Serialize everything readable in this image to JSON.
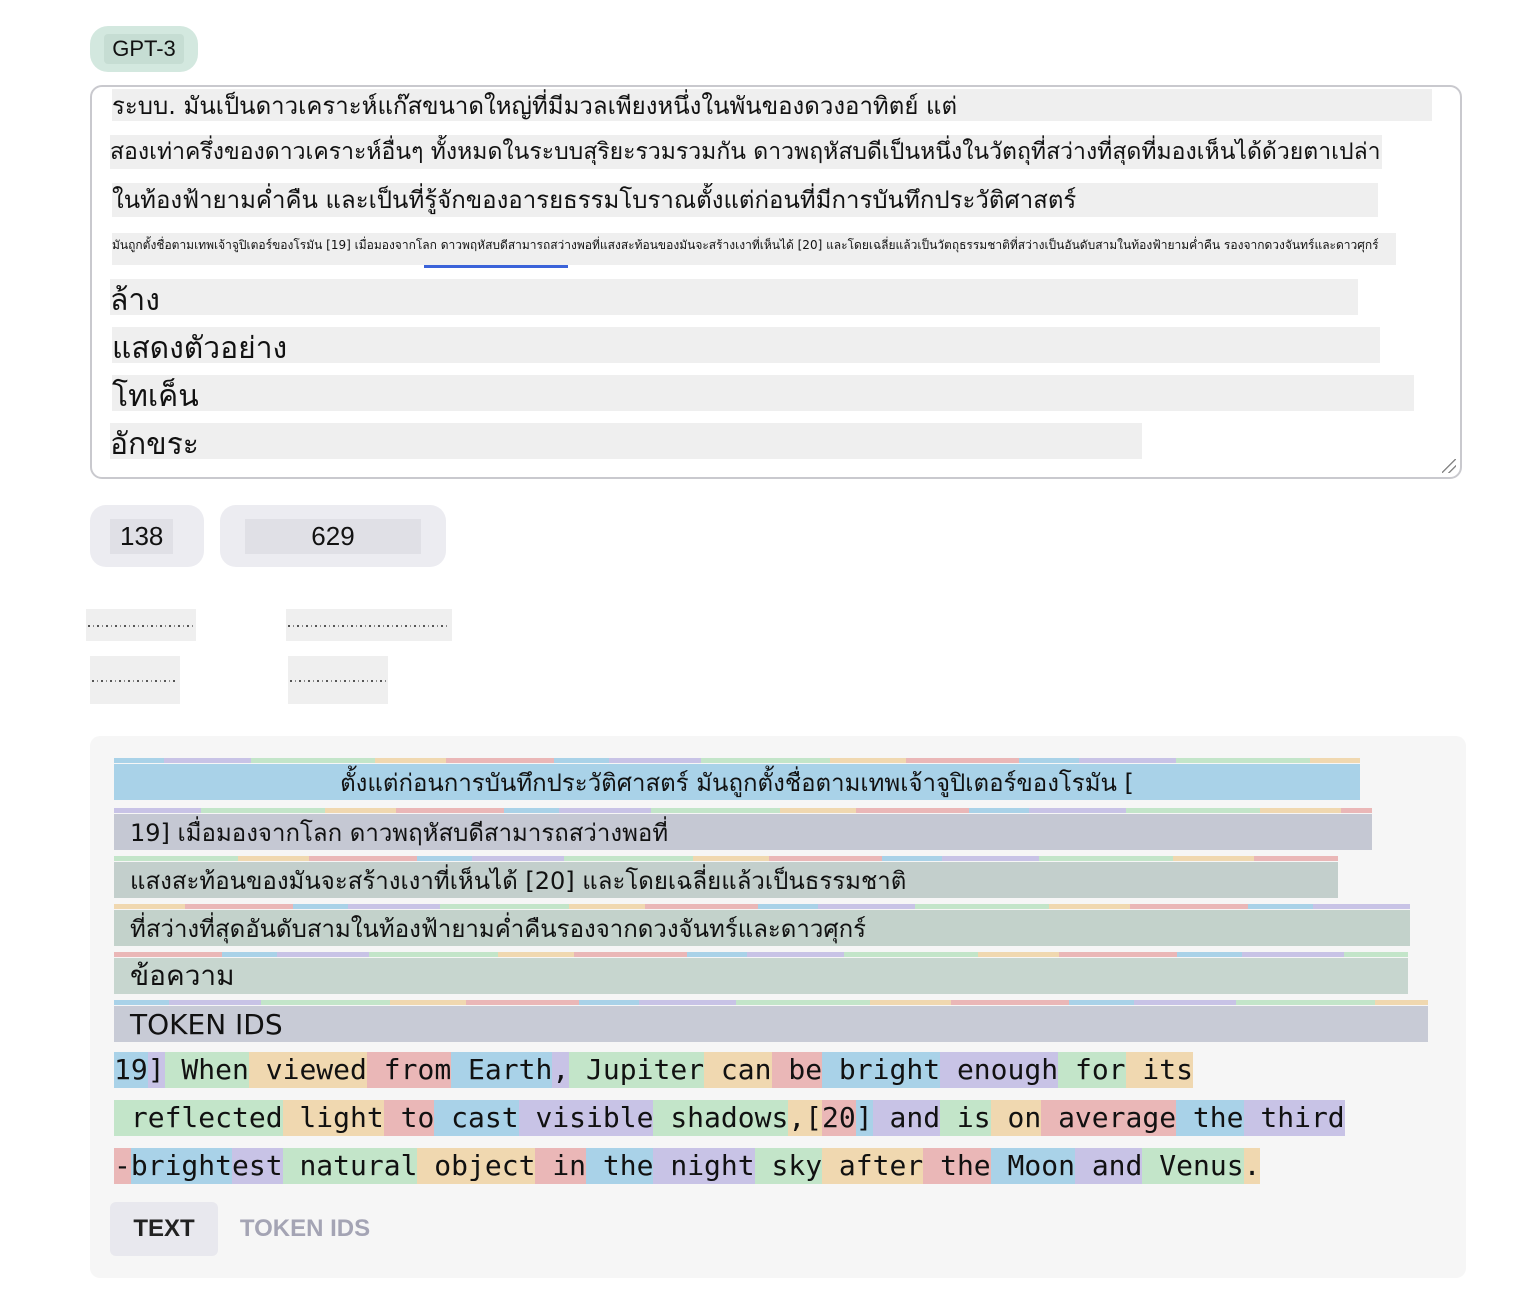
{
  "model": {
    "label": "GPT-3"
  },
  "textarea": {
    "lines": [
      "ระบบ. มันเป็นดาวเคราะห์แก๊สขนาดใหญ่ที่มีมวลเพียงหนึ่งในพันของดวงอาทิตย์ แต่",
      "สองเท่าครึ่งของดาวเคราะห์อื่นๆ ทั้งหมดในระบบสุริยะรวมรวมกัน ดาวพฤหัสบดีเป็นหนึ่งในวัตถุที่สว่างที่สุดที่มองเห็นได้ด้วยตาเปล่า",
      "ในท้องฟ้ายามค่ำคืน และเป็นที่รู้จักของอารยธรรมโบราณตั้งแต่ก่อนที่มีการบันทึกประวัติศาสตร์",
      "มันถูกตั้งชื่อตามเทพเจ้าจูปิเตอร์ของโรมัน [19] เมื่อมองจากโลก ดาวพฤหัสบดีสามารถสว่างพอที่แสงสะท้อนของมันจะสร้างเงาที่เห็นได้ [20] และโดยเฉลี่ยแล้วเป็นวัตถุธรรมชาติที่สว่างเป็นอันดับสามในท้องฟ้ายามค่ำคืน รองจากดวงจันทร์และดาวศุกร์",
      "ล้าง",
      "แสดงตัวอย่าง",
      "โทเค็น",
      "อักขระ"
    ]
  },
  "stats": {
    "tokens": "138",
    "characters": "629"
  },
  "token_view": {
    "thai_rows": [
      "ตั้งแต่ก่อนการบันทึกประวัติศาสตร์ มันถูกตั้งชื่อตามเทพเจ้าจูปิเตอร์ของโรมัน [",
      "19] เมื่อมองจากโลก ดาวพฤหัสบดีสามารถสว่างพอที่",
      "แสงสะท้อนของมันจะสร้างเงาที่เห็นได้ [20] และโดยเฉลี่ยแล้วเป็นธรรมชาติ",
      "ที่สว่างที่สุดอันดับสามในท้องฟ้ายามค่ำคืนรองจากดวงจันทร์และดาวศุกร์",
      "ข้อความ",
      "TOKEN IDS"
    ],
    "english_tokens": [
      [
        "19",
        "]",
        " When",
        " viewed",
        " from",
        " Earth",
        ",",
        " Jupiter",
        " can",
        " be",
        " bright",
        " enough",
        " for",
        " its"
      ],
      [
        " reflected",
        " light",
        " to",
        " cast",
        " visible",
        " shadows",
        ",[",
        "20",
        "]",
        " and",
        " is",
        " on",
        " average",
        " the",
        " third"
      ],
      [
        "-",
        "bright",
        "est",
        " natural",
        " object",
        " in",
        " the",
        " night",
        " sky",
        " after",
        " the",
        " Moon",
        " and",
        " Venus",
        "."
      ]
    ]
  },
  "tabs": {
    "text": "TEXT",
    "token_ids": "TOKEN IDS"
  },
  "colors": {
    "blue": "#a9d2e8",
    "purple": "#c8c3e6",
    "green": "#c3e5c9",
    "orange": "#f0d8b0",
    "red": "#eab7b7",
    "focus": "#3b63d9"
  }
}
